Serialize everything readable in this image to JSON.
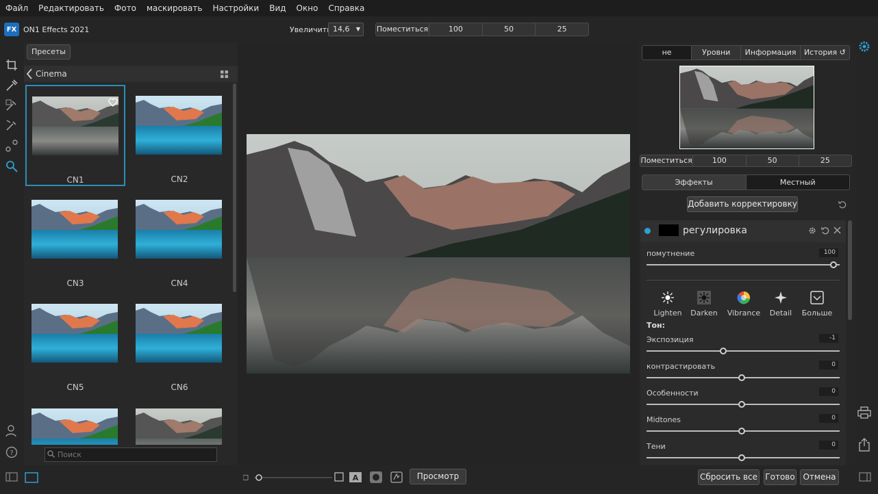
{
  "menu": [
    "Файл",
    "Редактировать",
    "Фото",
    "маскировать",
    "Настройки",
    "Вид",
    "Окно",
    "Справка"
  ],
  "app": {
    "logo_text": "FX",
    "title": "ON1 Effects 2021"
  },
  "zoom": {
    "label": "Увеличить",
    "value": "14,6",
    "fit": "Поместиться",
    "levels": [
      "100",
      "50",
      "25"
    ]
  },
  "presets": {
    "button": "Пресеты",
    "category": "Cinema",
    "items": [
      "CN1",
      "CN2",
      "CN3",
      "CN4",
      "CN5",
      "CN6"
    ],
    "search_placeholder": "Поиск"
  },
  "right_tabs": [
    "не",
    "Уровни",
    "Информация",
    "История"
  ],
  "navigator": {
    "fit": "Поместиться",
    "levels": [
      "100",
      "50",
      "25"
    ]
  },
  "effect_tabs": [
    "Эффекты",
    "Местный"
  ],
  "add_adjustment": "Добавить корректировку",
  "adjustment": {
    "title": "регулировка",
    "opacity": {
      "label": "помутнение",
      "value": "100",
      "level": 1.0
    },
    "modes": [
      "Lighten",
      "Darken",
      "Vibrance",
      "Detail",
      "Больше"
    ],
    "tone_label": "Тон:",
    "sliders": [
      {
        "label": "Экспозиция",
        "value": "-1",
        "level": 0.4
      },
      {
        "label": "контрастировать",
        "value": "0",
        "level": 0.5
      },
      {
        "label": "Особенности",
        "value": "0",
        "level": 0.5
      },
      {
        "label": "Midtones",
        "value": "0",
        "level": 0.5
      },
      {
        "label": "Тени",
        "value": "0",
        "level": 0.5
      }
    ]
  },
  "bottom": {
    "preview": "Просмотр",
    "reset": "Сбросить все",
    "done": "Готово",
    "cancel": "Отмена"
  },
  "colors": {
    "accent": "#2a8fb8",
    "logo": "#1c6fbf"
  }
}
